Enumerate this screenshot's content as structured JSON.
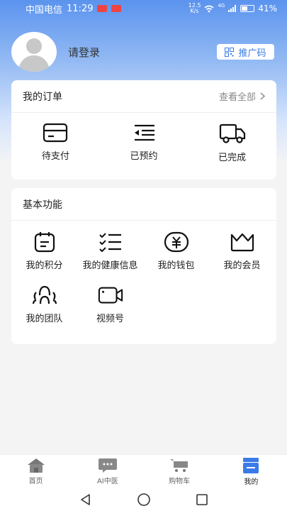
{
  "status_bar": {
    "carrier": "中国电信",
    "time": "11:29",
    "net_speed_value": "12.5",
    "net_speed_unit": "K/s",
    "signal_label": "4G",
    "battery": "41%"
  },
  "profile": {
    "login_text": "请登录",
    "promo_button": "推广码"
  },
  "orders": {
    "title": "我的订单",
    "view_all": "查看全部",
    "items": [
      {
        "label": "待支付",
        "icon": "card-icon"
      },
      {
        "label": "已预约",
        "icon": "list-indent-icon"
      },
      {
        "label": "已完成",
        "icon": "truck-icon"
      }
    ]
  },
  "functions": {
    "title": "基本功能",
    "items": [
      {
        "label": "我的积分",
        "icon": "calendar-points-icon"
      },
      {
        "label": "我的健康信息",
        "icon": "checklist-icon"
      },
      {
        "label": "我的钱包",
        "icon": "yuan-wallet-icon"
      },
      {
        "label": "我的会员",
        "icon": "crown-icon"
      },
      {
        "label": "我的团队",
        "icon": "team-icon"
      },
      {
        "label": "视频号",
        "icon": "video-camera-icon"
      }
    ]
  },
  "tabbar": {
    "active": "我的",
    "tabs": [
      {
        "label": "首页",
        "icon": "home-icon"
      },
      {
        "label": "AI中医",
        "icon": "chat-icon"
      },
      {
        "label": "购物车",
        "icon": "cart-icon"
      },
      {
        "label": "我的",
        "icon": "mine-icon"
      }
    ]
  },
  "colors": {
    "accent": "#3b7be8",
    "header_gradient_top": "#5b93ee"
  }
}
